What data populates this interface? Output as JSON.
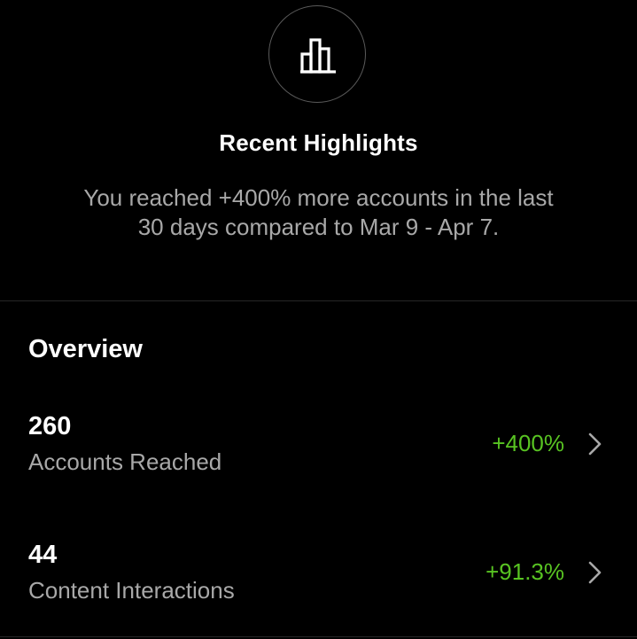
{
  "highlights": {
    "icon": "bar-chart-icon",
    "title": "Recent Highlights",
    "description_line1": "You reached +400% more accounts in the last",
    "description_line2": "30 days compared to Mar 9 - Apr 7."
  },
  "overview": {
    "title": "Overview",
    "metrics": [
      {
        "value": "260",
        "label": "Accounts Reached",
        "change": "+400%"
      },
      {
        "value": "44",
        "label": "Content Interactions",
        "change": "+91.3%"
      }
    ]
  },
  "colors": {
    "background": "#000000",
    "primary_text": "#ffffff",
    "secondary_text": "#a8a8a8",
    "positive": "#58c322",
    "divider": "#262626"
  }
}
